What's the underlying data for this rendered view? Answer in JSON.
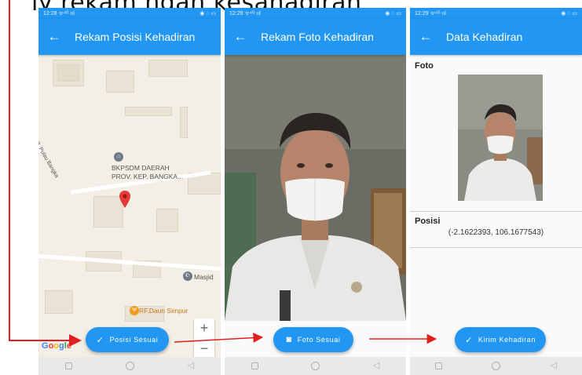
{
  "caption": "ly rekam ngan kesahadiran",
  "status": {
    "phone1_time": "12:28",
    "phone2_time": "12:29",
    "phone3_time": "12:29",
    "signal": "ᯤ⁴ᴳ ııl",
    "indicators": "◉ ◌ ▭"
  },
  "screens": [
    {
      "title": "Rekam Posisi Kehadiran",
      "button": "Posisi Sesuai",
      "map": {
        "street": "Jl. Pulau Bangka",
        "poi_main": "BKPSDM DAERAH\nPROV. KEP. BANGKA...",
        "poi_mosque": "Masjid",
        "poi_restaurant": "RF.Daun Simpur",
        "zoom_in": "+",
        "zoom_out": "−",
        "google": [
          "G",
          "o",
          "o",
          "g",
          "l",
          "e"
        ]
      }
    },
    {
      "title": "Rekam Foto Kehadiran",
      "button": "Foto Sesuai"
    },
    {
      "title": "Data Kehadiran",
      "foto_label": "Foto",
      "posisi_label": "Posisi",
      "coordinates": "(-2.1622393, 106.1677543)",
      "button": "Kirim Kehadiran"
    }
  ],
  "colors": {
    "primary": "#2196f3",
    "arrow": "#e02020",
    "pin": "#e53935"
  },
  "icons": {
    "back": "arrow-left-icon",
    "check": "check-icon",
    "camera": "camera-icon",
    "pin": "map-pin-icon"
  }
}
